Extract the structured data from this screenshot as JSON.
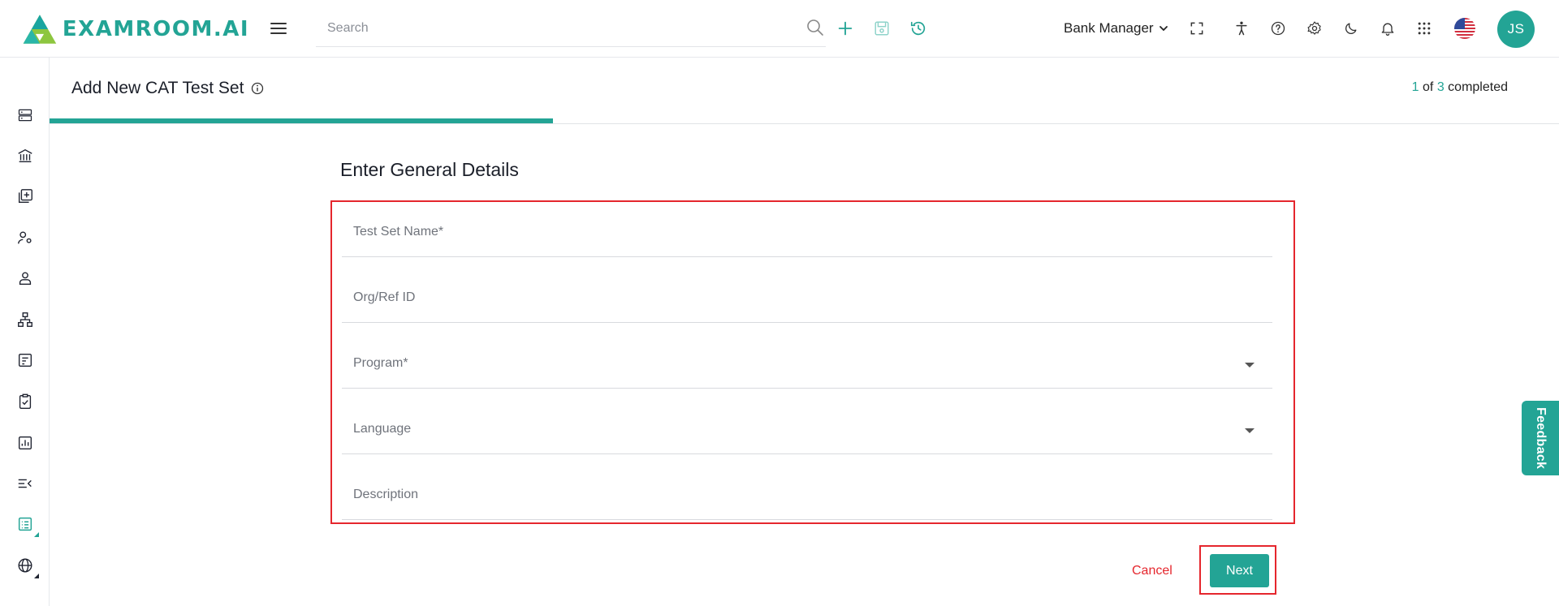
{
  "header": {
    "brand": "EXAMROOM.AI",
    "search_placeholder": "Search",
    "role": "Bank Manager",
    "avatar_initials": "JS",
    "icons": [
      "menu-icon",
      "search-icon",
      "add-icon",
      "save-icon",
      "history-icon",
      "chevron-down-icon",
      "fullscreen-icon",
      "accessibility-icon",
      "help-icon",
      "settings-icon",
      "dark-mode-icon",
      "notifications-icon",
      "apps-grid-icon",
      "us-flag-icon"
    ]
  },
  "sidebar": {
    "items": [
      {
        "icon": "server-icon"
      },
      {
        "icon": "bank-icon"
      },
      {
        "icon": "add-library-icon"
      },
      {
        "icon": "user-settings-icon"
      },
      {
        "icon": "user-icon"
      },
      {
        "icon": "hierarchy-icon"
      },
      {
        "icon": "form-icon"
      },
      {
        "icon": "clipboard-check-icon"
      },
      {
        "icon": "report-icon"
      },
      {
        "icon": "list-collapse-icon"
      },
      {
        "icon": "test-set-icon",
        "active": true
      },
      {
        "icon": "globe-settings-icon"
      }
    ]
  },
  "page": {
    "title": "Add New CAT Test Set",
    "step_current": "1",
    "step_of": "of",
    "step_total": "3",
    "step_suffix": "completed",
    "progress_fraction": 0.333
  },
  "form": {
    "section_title": "Enter General Details",
    "fields": [
      {
        "placeholder": "Test Set Name*",
        "type": "text"
      },
      {
        "placeholder": "Org/Ref ID",
        "type": "text"
      },
      {
        "placeholder": "Program*",
        "type": "select"
      },
      {
        "placeholder": "Language",
        "type": "select"
      },
      {
        "placeholder": "Description",
        "type": "text"
      }
    ],
    "cancel_label": "Cancel",
    "next_label": "Next"
  },
  "feedback_label": "Feedback",
  "colors": {
    "accent": "#23a495",
    "highlight": "#e5262d"
  }
}
